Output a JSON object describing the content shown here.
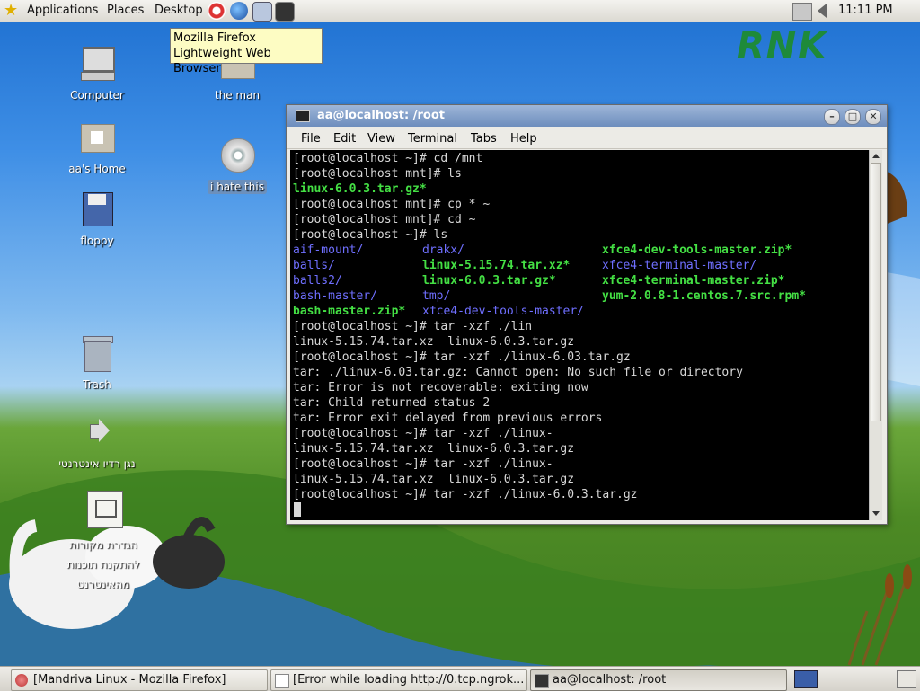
{
  "top_panel": {
    "menus": [
      "Applications",
      "Places",
      "Desktop"
    ],
    "launchers": [
      "help-icon",
      "firefox-icon",
      "mail-icon",
      "terminal-launcher-icon"
    ],
    "clock": "11:11 PM"
  },
  "tooltip": {
    "line1": "Mozilla Firefox",
    "line2": "Lightweight Web Browser"
  },
  "desktop": {
    "logo": "RNK",
    "icons": [
      {
        "label": "Computer"
      },
      {
        "label": "the man"
      },
      {
        "label": "aa's Home"
      },
      {
        "label": "i hate this"
      },
      {
        "label": "floppy"
      },
      {
        "label": "Trash"
      },
      {
        "label": "נגן רדיו אינטרנטי"
      },
      {
        "label": "הגדרת מקורות להתקנת תוכנות מהאינטרנט"
      }
    ]
  },
  "terminal": {
    "title": "aa@localhost: /root",
    "menu": [
      "File",
      "Edit",
      "View",
      "Terminal",
      "Tabs",
      "Help"
    ],
    "lines": [
      "[root@localhost ~]# cd /mnt",
      "[root@localhost mnt]# ls",
      "linux-6.0.3.tar.gz*",
      "[root@localhost mnt]# cp * ~",
      "[root@localhost mnt]# cd ~",
      "[root@localhost ~]# ls",
      "aif-mount/",
      "drakx/",
      "xfce4-dev-tools-master.zip*",
      "balls/",
      "linux-5.15.74.tar.xz*",
      "xfce4-terminal-master/",
      "balls2/",
      "linux-6.0.3.tar.gz*",
      "xfce4-terminal-master.zip*",
      "bash-master/",
      "tmp/",
      "yum-2.0.8-1.centos.7.src.rpm*",
      "bash-master.zip*",
      "xfce4-dev-tools-master/",
      "[root@localhost ~]# tar -xzf ./lin",
      "linux-5.15.74.tar.xz  linux-6.0.3.tar.gz",
      "[root@localhost ~]# tar -xzf ./linux-6.03.tar.gz",
      "tar: ./linux-6.03.tar.gz: Cannot open: No such file or directory",
      "tar: Error is not recoverable: exiting now",
      "tar: Child returned status 2",
      "tar: Error exit delayed from previous errors",
      "[root@localhost ~]# tar -xzf ./linux-",
      "linux-5.15.74.tar.xz  linux-6.0.3.tar.gz",
      "[root@localhost ~]# tar -xzf ./linux-",
      "linux-5.15.74.tar.xz  linux-6.0.3.tar.gz",
      "[root@localhost ~]# tar -xzf ./linux-6.0.3.tar.gz"
    ]
  },
  "taskbar": {
    "tasks": [
      "[Mandriva Linux - Mozilla Firefox]",
      "[Error while loading http://0.tcp.ngrok...",
      "aa@localhost: /root"
    ]
  },
  "colors": {
    "terminal_bg": "#000000",
    "dir": "#6f6fff",
    "archive": "#44e044",
    "tooltip_bg": "#fdfcc3"
  }
}
